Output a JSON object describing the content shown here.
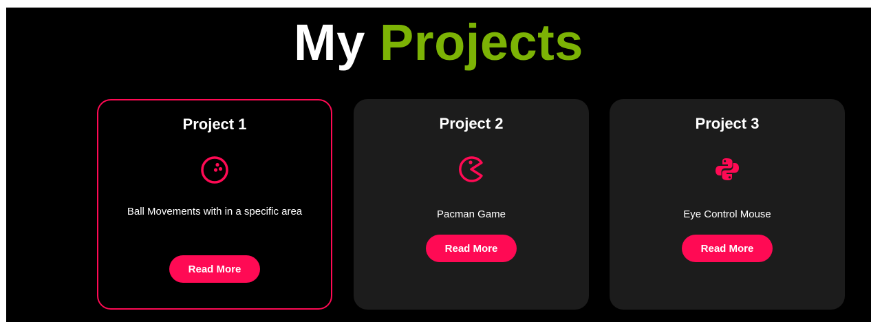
{
  "heading": {
    "part1": "My",
    "part2": "Projects"
  },
  "colors": {
    "accent": "#ff0a54",
    "highlight": "#7cb305",
    "card_bg": "#1c1c1c",
    "page_bg": "#000000"
  },
  "projects": [
    {
      "title": "Project 1",
      "icon": "bowling-ball-icon",
      "description": "Ball Movements with in a specific area",
      "button": "Read More",
      "active": true
    },
    {
      "title": "Project 2",
      "icon": "pacman-icon",
      "description": "Pacman Game",
      "button": "Read More",
      "active": false
    },
    {
      "title": "Project 3",
      "icon": "python-icon",
      "description": "Eye Control Mouse",
      "button": "Read More",
      "active": false
    }
  ]
}
